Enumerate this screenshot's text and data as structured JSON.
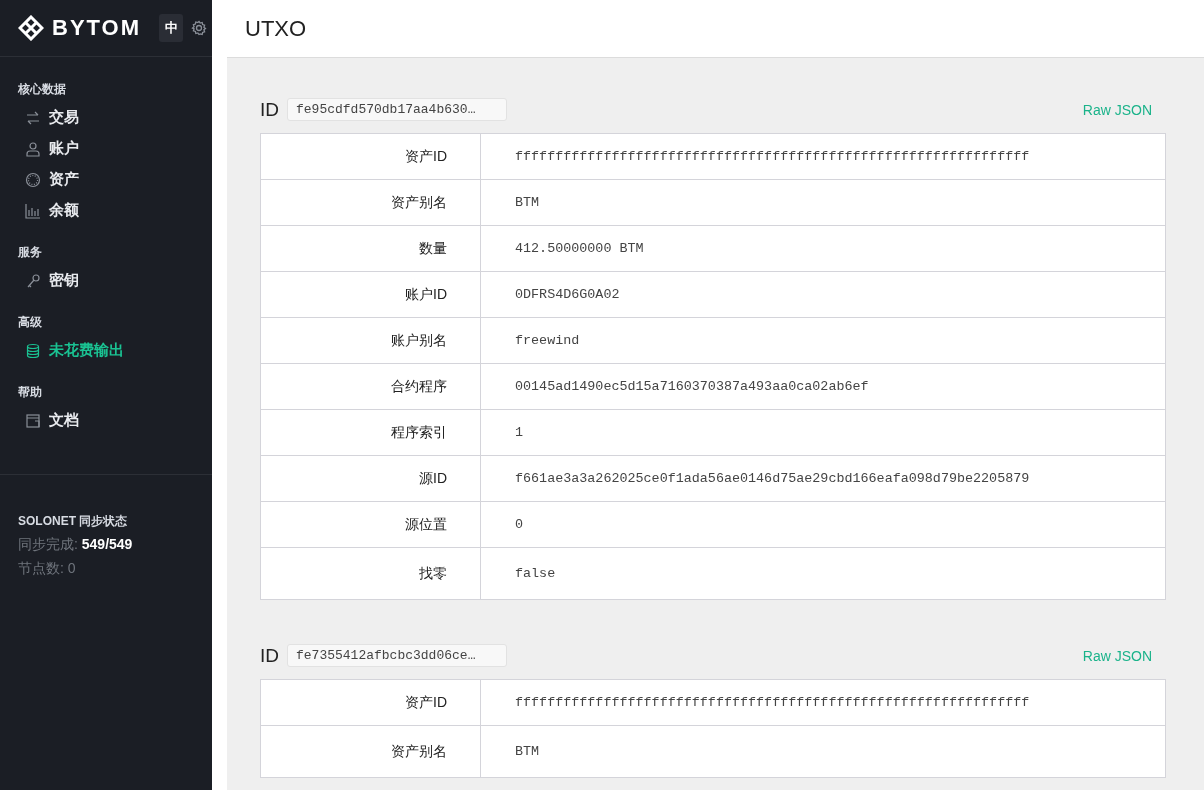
{
  "sidebar": {
    "brand": "BYTOM",
    "language": "中",
    "sections": [
      {
        "title": "核心数据",
        "items": [
          {
            "label": "交易",
            "kind": "transfer",
            "selected": false
          },
          {
            "label": "账户",
            "kind": "user",
            "selected": false
          },
          {
            "label": "资产",
            "kind": "circle",
            "selected": false
          },
          {
            "label": "余额",
            "kind": "bars",
            "selected": false
          }
        ]
      },
      {
        "title": "服务",
        "items": [
          {
            "label": "密钥",
            "kind": "key",
            "selected": false
          }
        ]
      },
      {
        "title": "高级",
        "items": [
          {
            "label": "未花费输出",
            "kind": "database",
            "selected": true
          }
        ]
      },
      {
        "title": "帮助",
        "items": [
          {
            "label": "文档",
            "kind": "book",
            "selected": false
          }
        ]
      }
    ],
    "status": {
      "title": "SOLONET 同步状态",
      "sync_label": "同步完成:",
      "sync_value": "549/549",
      "peers": "节点数: 0"
    }
  },
  "page_title": "UTXO",
  "utxos": [
    {
      "id_label": "ID",
      "id": "fe95cdfd570db17aa4b630…",
      "raw_json": "Raw JSON",
      "rows": [
        {
          "label": "资产ID",
          "value": "ffffffffffffffffffffffffffffffffffffffffffffffffffffffffffffffff"
        },
        {
          "label": "资产别名",
          "value": "BTM"
        },
        {
          "label": "数量",
          "value": "412.50000000 BTM"
        },
        {
          "label": "账户ID",
          "value": "0DFRS4D6G0A02"
        },
        {
          "label": "账户别名",
          "value": "freewind"
        },
        {
          "label": "合约程序",
          "value": "00145ad1490ec5d15a7160370387a493aa0ca02ab6ef"
        },
        {
          "label": "程序索引",
          "value": "1"
        },
        {
          "label": "源ID",
          "value": "f661ae3a3a262025ce0f1ada56ae0146d75ae29cbd166eafa098d79be2205879"
        },
        {
          "label": "源位置",
          "value": "0"
        },
        {
          "label": "找零",
          "value": "false"
        }
      ]
    },
    {
      "id_label": "ID",
      "id": "fe7355412afbcbc3dd06ce…",
      "raw_json": "Raw JSON",
      "rows": [
        {
          "label": "资产ID",
          "value": "ffffffffffffffffffffffffffffffffffffffffffffffffffffffffffffffff"
        },
        {
          "label": "资产别名",
          "value": "BTM"
        }
      ]
    }
  ]
}
